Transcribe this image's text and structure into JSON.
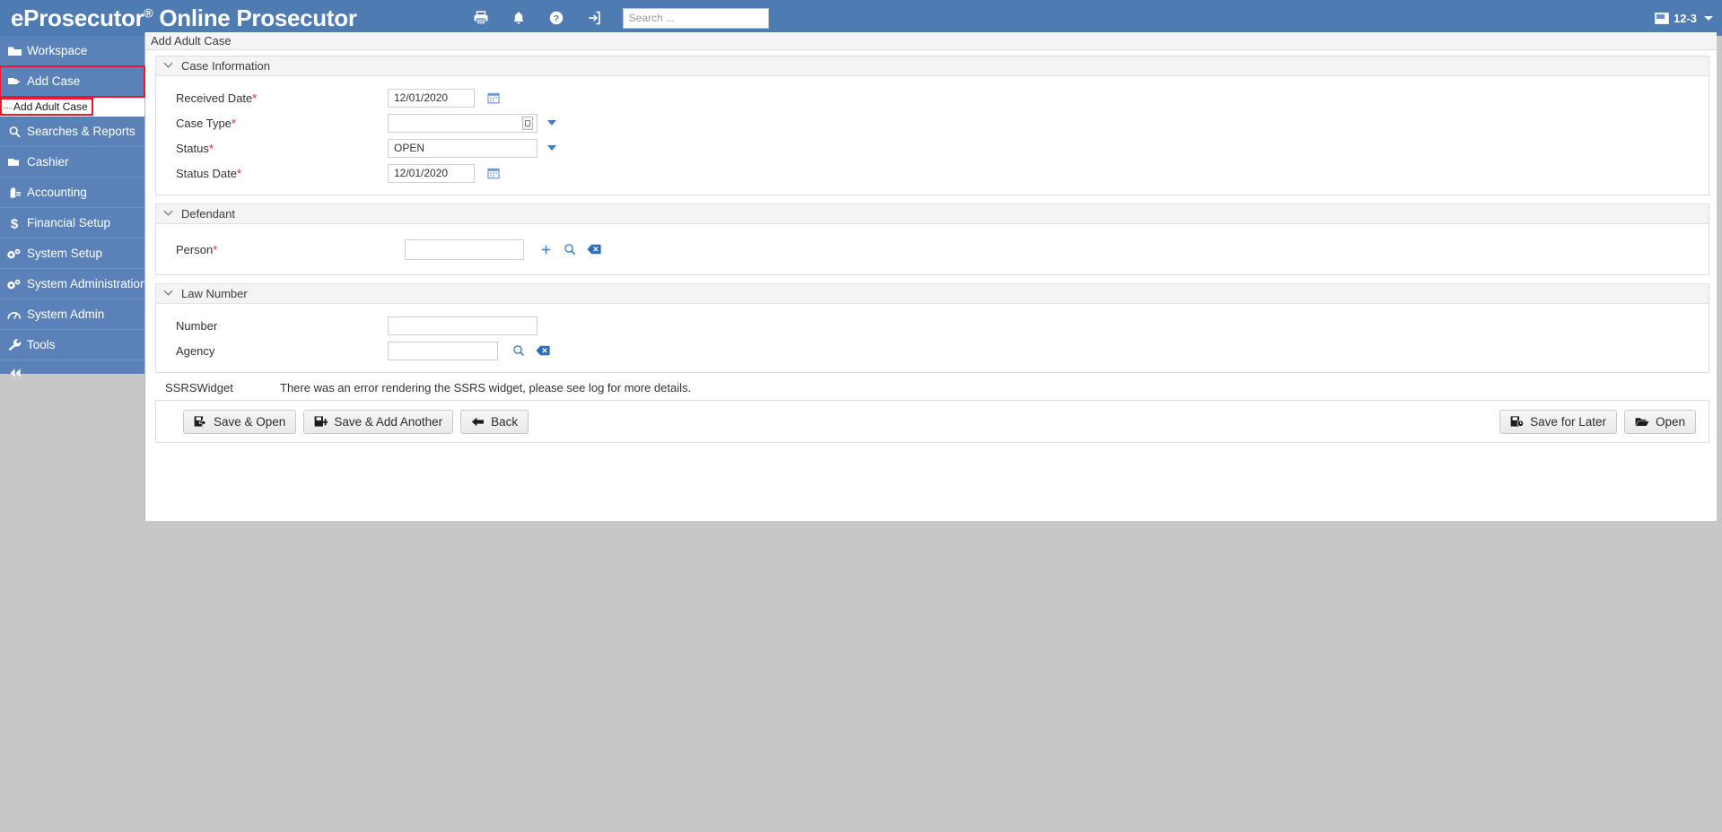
{
  "header": {
    "brand_main": "eProsecutor",
    "brand_reg": "®",
    "brand_sub": " Online Prosecutor",
    "icons": [
      {
        "name": "print-icon",
        "label": "Print"
      },
      {
        "name": "notifications-bell-icon",
        "label": "Notifications"
      },
      {
        "name": "help-icon",
        "label": "Help"
      },
      {
        "name": "sign-out-icon",
        "label": "Sign Out"
      }
    ],
    "search_placeholder": "Search ...",
    "search_value": "",
    "user_label": "12-3"
  },
  "sidebar": {
    "items": [
      {
        "label": "Workspace",
        "icon": "workspace-icon",
        "highlighted": false
      },
      {
        "label": "Add Case",
        "icon": "add-case-icon",
        "highlighted": true
      },
      {
        "label": "Searches & Reports",
        "icon": "search-icon",
        "highlighted": false
      },
      {
        "label": "Cashier",
        "icon": "cashier-icon",
        "highlighted": false
      },
      {
        "label": "Accounting",
        "icon": "accounting-icon",
        "highlighted": false
      },
      {
        "label": "Financial Setup",
        "icon": "dollar-icon",
        "highlighted": false
      },
      {
        "label": "System Setup",
        "icon": "gears-icon",
        "highlighted": false
      },
      {
        "label": "System Administration",
        "icon": "gears-icon",
        "highlighted": false
      },
      {
        "label": "System Admin",
        "icon": "gauge-icon",
        "highlighted": false
      },
      {
        "label": "Tools",
        "icon": "wrench-icon",
        "highlighted": false
      }
    ],
    "submenu_item": "Add Adult Case",
    "collapse_icon": "collapse-left-icon"
  },
  "page": {
    "title": "Add Adult Case"
  },
  "sections": {
    "case_information": {
      "title": "Case Information",
      "fields": {
        "received_date": {
          "label": "Received Date",
          "required": "*",
          "value": "12/01/2020",
          "calendar_icon": "calendar-icon"
        },
        "case_type": {
          "label": "Case Type",
          "required": "*",
          "value": "",
          "picker_icon": "lookup-icon",
          "dropdown_icon": "chevron-down-icon"
        },
        "status": {
          "label": "Status",
          "required": "*",
          "value": "OPEN",
          "dropdown_icon": "chevron-down-icon"
        },
        "status_date": {
          "label": "Status Date",
          "required": "*",
          "value": "12/01/2020",
          "calendar_icon": "calendar-icon"
        }
      }
    },
    "defendant": {
      "title": "Defendant",
      "fields": {
        "person": {
          "label": "Person",
          "required": "*",
          "value": "",
          "actions": [
            {
              "name": "add-person-icon",
              "label": "Add"
            },
            {
              "name": "search-person-icon",
              "label": "Search"
            },
            {
              "name": "clear-person-icon",
              "label": "Clear"
            }
          ]
        }
      }
    },
    "law_number": {
      "title": "Law Number",
      "fields": {
        "number": {
          "label": "Number",
          "value": ""
        },
        "agency": {
          "label": "Agency",
          "value": "",
          "actions": [
            {
              "name": "search-agency-icon",
              "label": "Search"
            },
            {
              "name": "clear-agency-icon",
              "label": "Clear"
            }
          ]
        }
      }
    }
  },
  "ssrs": {
    "label": "SSRSWidget",
    "message": "There was an error rendering the SSRS widget, please see log for more details."
  },
  "buttons": {
    "left": [
      {
        "label": "Save & Open",
        "icon": "save-open-icon"
      },
      {
        "label": "Save & Add Another",
        "icon": "save-add-icon"
      },
      {
        "label": "Back",
        "icon": "back-arrow-icon"
      }
    ],
    "right": [
      {
        "label": "Save for Later",
        "icon": "save-later-icon"
      },
      {
        "label": "Open",
        "icon": "folder-open-icon"
      }
    ]
  },
  "colors": {
    "header_blue": "#4f7bb3",
    "sidebar_blue": "#5b82b8",
    "highlight_red": "#e8192c",
    "accent_link": "#3f7fc1",
    "required_red": "#d8272c",
    "page_background": "#c7c7c7"
  }
}
